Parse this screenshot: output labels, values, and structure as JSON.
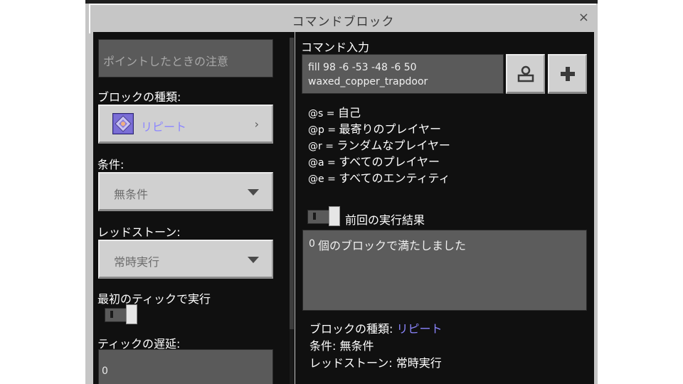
{
  "window": {
    "title": "コマンドブロック",
    "close": "×"
  },
  "left": {
    "hover_note_placeholder": "ポイントしたときの注意",
    "block_type_label": "ブロックの種類:",
    "block_type_value": "リピート",
    "condition_label": "条件:",
    "condition_value": "無条件",
    "redstone_label": "レッドストーン:",
    "redstone_value": "常時実行",
    "first_tick_label": "最初のティックで実行",
    "first_tick_toggle": false,
    "tick_delay_label": "ティックの遅延:",
    "tick_delay_value": "0"
  },
  "right": {
    "command_input_label": "コマンド入力",
    "command_line1": "fill 98 -6 -53 -48 -6 50",
    "command_line2": "waxed_copper_trapdoor",
    "selectors": [
      {
        "key": "@s",
        "sep": " = ",
        "desc": "自己"
      },
      {
        "key": "@p",
        "sep": " = ",
        "desc": "最寄りのプレイヤー"
      },
      {
        "key": "@r",
        "sep": " = ",
        "desc": "ランダムなプレイヤー"
      },
      {
        "key": "@a",
        "sep": " = ",
        "desc": "すべてのプレイヤー"
      },
      {
        "key": "@e",
        "sep": " = ",
        "desc": "すべてのエンティティ"
      }
    ],
    "previous_output_label": "前回の実行結果",
    "previous_output_toggle": false,
    "output_count": "0",
    "output_text": "個のブロックで満たしました",
    "summary_block_type_label": "ブロックの種類:",
    "summary_block_type_value": "リピート",
    "summary_condition_label": "条件:",
    "summary_condition_value": "無条件",
    "summary_redstone_label": "レッドストーン:",
    "summary_redstone_value": "常時実行"
  },
  "colors": {
    "accent_purple": "#8c86ff",
    "panel_bg": "#101010",
    "frame_bg": "#c6c6c6"
  }
}
